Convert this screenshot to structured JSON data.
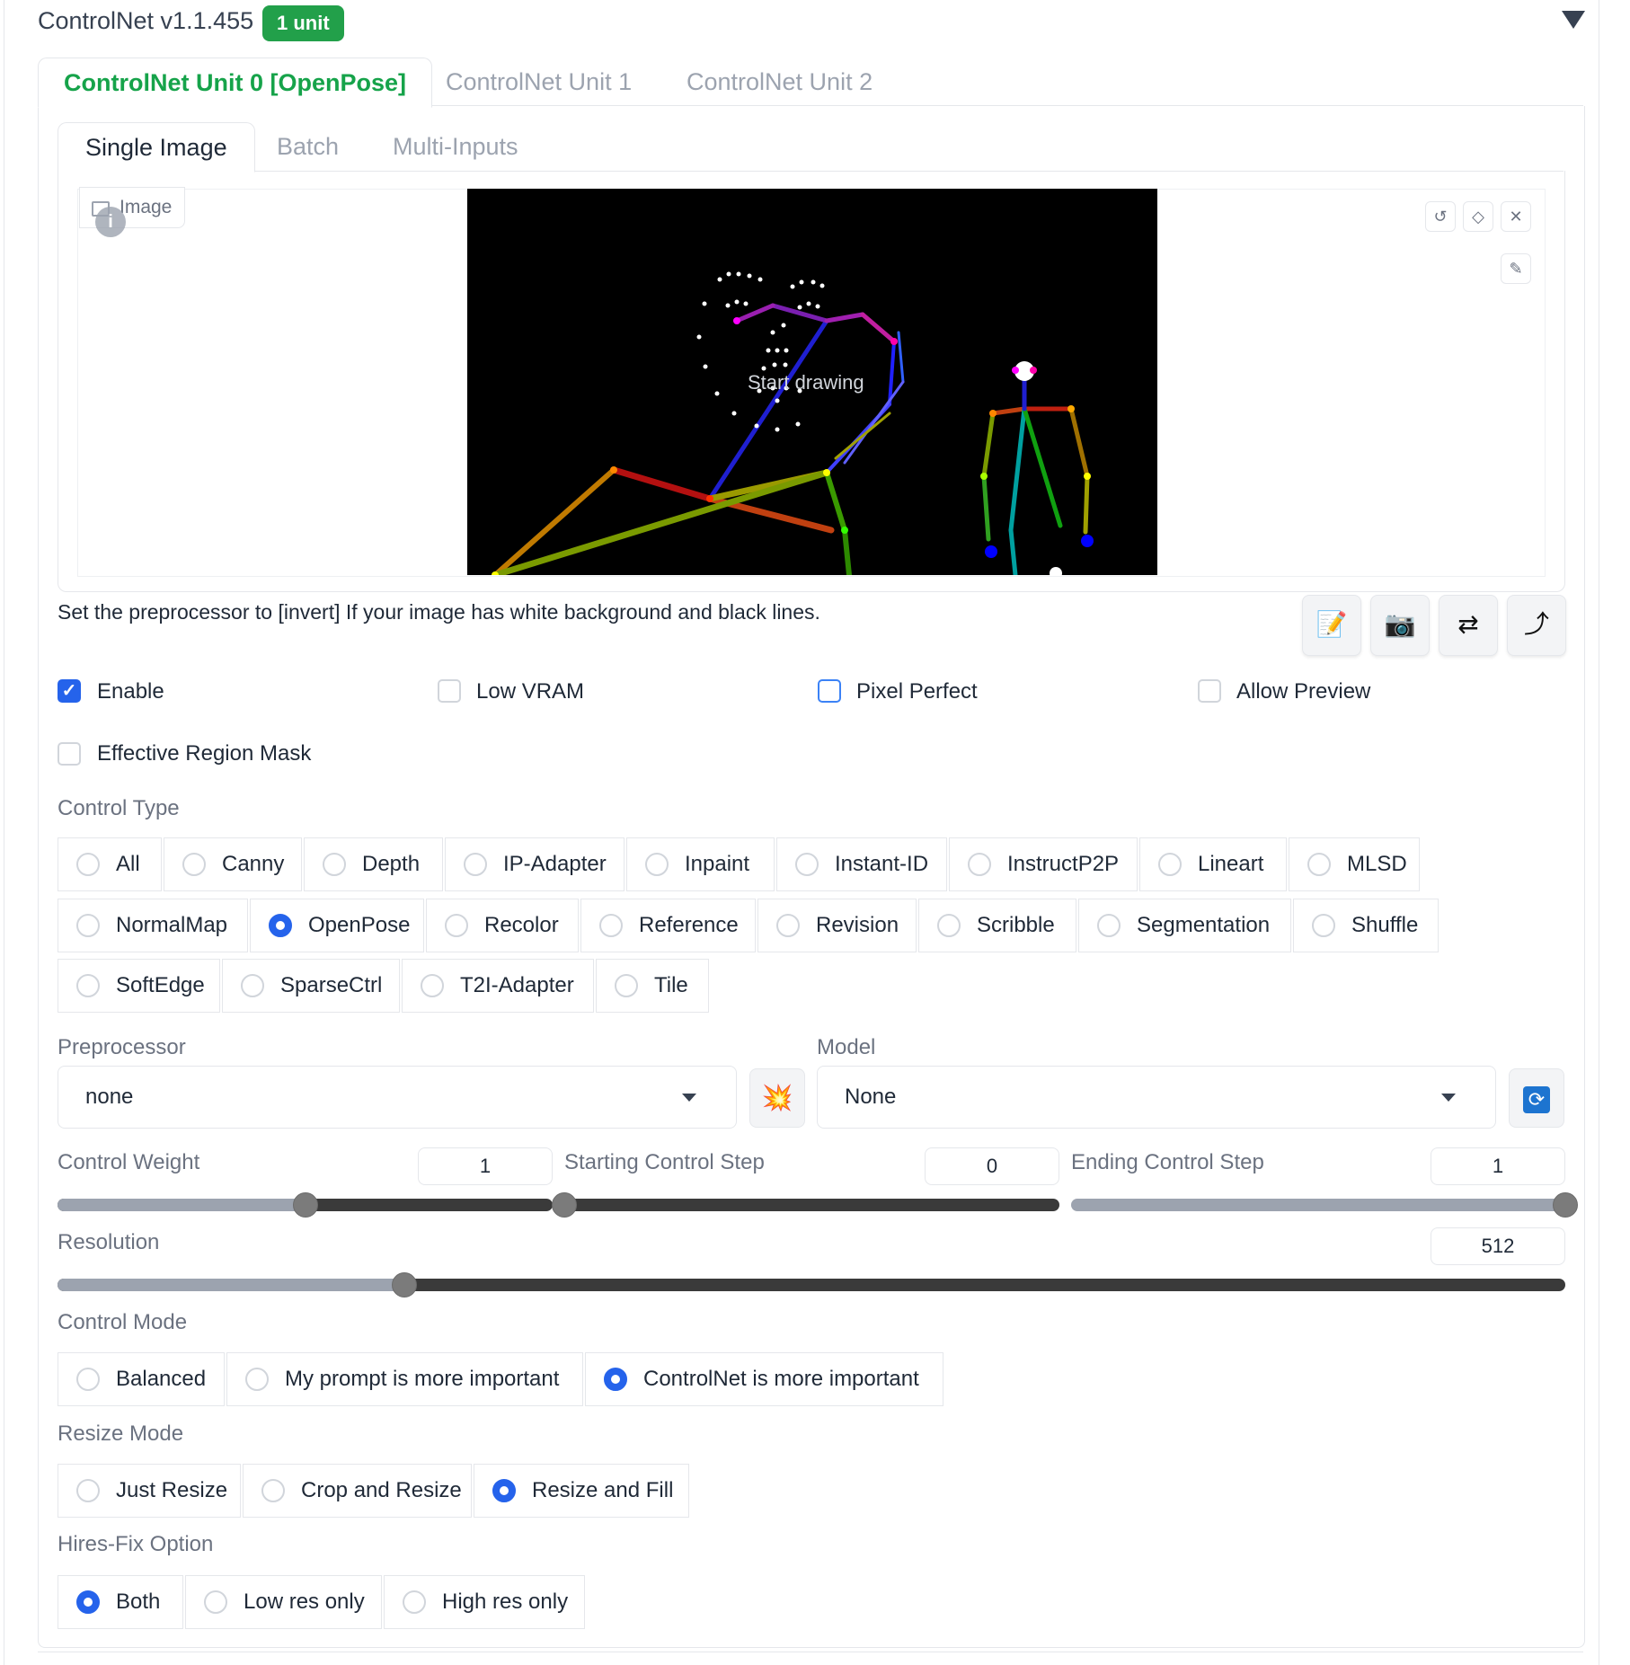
{
  "header": {
    "title": "ControlNet v1.1.455",
    "badge": "1 unit"
  },
  "unit_tabs": [
    {
      "label": "ControlNet Unit 0 [OpenPose]"
    },
    {
      "label": "ControlNet Unit 1"
    },
    {
      "label": "ControlNet Unit 2"
    }
  ],
  "mode_tabs": [
    {
      "label": "Single Image"
    },
    {
      "label": "Batch"
    },
    {
      "label": "Multi-Inputs"
    }
  ],
  "image": {
    "label": "Image",
    "overlay_text": "Start drawing"
  },
  "hint": "Set the preprocessor to [invert] If your image has white background and black lines.",
  "checkboxes": {
    "enable": {
      "label": "Enable",
      "checked": true
    },
    "low_vram": {
      "label": "Low VRAM",
      "checked": false
    },
    "pixel_perfect": {
      "label": "Pixel Perfect",
      "checked": false
    },
    "allow_preview": {
      "label": "Allow Preview",
      "checked": false
    },
    "effective_region_mask": {
      "label": "Effective Region Mask",
      "checked": false
    }
  },
  "control_type": {
    "label": "Control Type",
    "selected": "OpenPose",
    "options": [
      "All",
      "Canny",
      "Depth",
      "IP-Adapter",
      "Inpaint",
      "Instant-ID",
      "InstructP2P",
      "Lineart",
      "MLSD",
      "NormalMap",
      "OpenPose",
      "Recolor",
      "Reference",
      "Revision",
      "Scribble",
      "Segmentation",
      "Shuffle",
      "SoftEdge",
      "SparseCtrl",
      "T2I-Adapter",
      "Tile"
    ]
  },
  "preprocessor": {
    "label": "Preprocessor",
    "value": "none"
  },
  "model": {
    "label": "Model",
    "value": "None"
  },
  "control_weight": {
    "label": "Control Weight",
    "value": "1",
    "fraction": 0.5
  },
  "starting_step": {
    "label": "Starting Control Step",
    "value": "0",
    "fraction": 0.0
  },
  "ending_step": {
    "label": "Ending Control Step",
    "value": "1",
    "fraction": 1.0
  },
  "resolution": {
    "label": "Resolution",
    "value": "512",
    "fraction": 0.23
  },
  "control_mode": {
    "label": "Control Mode",
    "selected": "ControlNet is more important",
    "options": [
      "Balanced",
      "My prompt is more important",
      "ControlNet is more important"
    ]
  },
  "resize_mode": {
    "label": "Resize Mode",
    "selected": "Resize and Fill",
    "options": [
      "Just Resize",
      "Crop and Resize",
      "Resize and Fill"
    ]
  },
  "hires_fix": {
    "label": "Hires-Fix Option",
    "selected": "Both",
    "options": [
      "Both",
      "Low res only",
      "High res only"
    ]
  },
  "colors": {
    "accent": "#2563eb",
    "badge": "#22a04a",
    "active_tab": "#16a34a"
  }
}
